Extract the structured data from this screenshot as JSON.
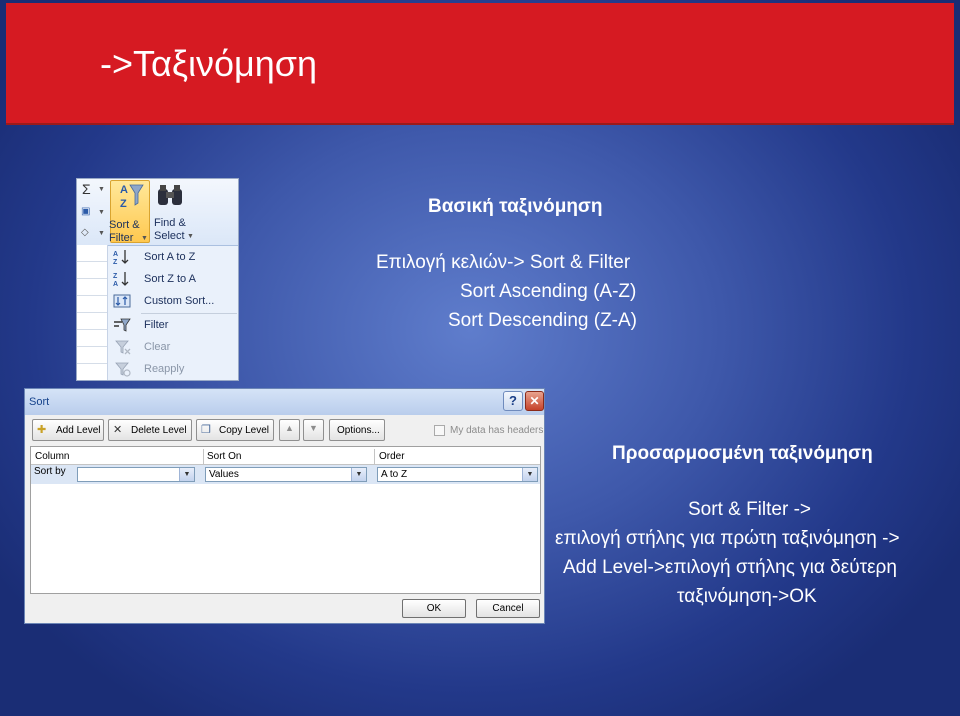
{
  "slide_title": "->Ταξινόμηση",
  "basic": {
    "heading": "Βασική ταξινόμηση",
    "line1": "Επιλογή κελιών-> Sort & Filter",
    "line2": "Sort Ascending (A-Z)",
    "line3": "Sort Descending (Z-A)"
  },
  "custom": {
    "heading": "Προσαρμοσμένη ταξινόμηση",
    "line1": "Sort & Filter ->",
    "line2": "επιλογή στήλης για πρώτη ταξινόμηση ->",
    "line3": "Add Level->επιλογή στήλης για δεύτερη",
    "line4": "ταξινόμηση->ΟΚ"
  },
  "ribbon": {
    "sort_filter_line1": "Sort &",
    "sort_filter_line2": "Filter",
    "find_select_line1": "Find &",
    "find_select_line2": "Select",
    "menu": [
      {
        "label": "Sort A to Z",
        "enabled": true
      },
      {
        "label": "Sort Z to A",
        "enabled": true
      },
      {
        "label": "Custom Sort...",
        "enabled": true
      },
      {
        "label": "Filter",
        "enabled": true
      },
      {
        "label": "Clear",
        "enabled": false
      },
      {
        "label": "Reapply",
        "enabled": false
      }
    ]
  },
  "dialog": {
    "title": "Sort",
    "help": "?",
    "close": "✕",
    "buttons": {
      "add_level": "Add Level",
      "delete_level": "Delete Level",
      "copy_level": "Copy Level",
      "options": "Options..."
    },
    "headers_checkbox": "My data has headers",
    "columns": [
      "Column",
      "Sort On",
      "Order"
    ],
    "row_label": "Sort by",
    "sort_on_value": "Values",
    "order_value": "A to Z",
    "ok": "OK",
    "cancel": "Cancel"
  }
}
